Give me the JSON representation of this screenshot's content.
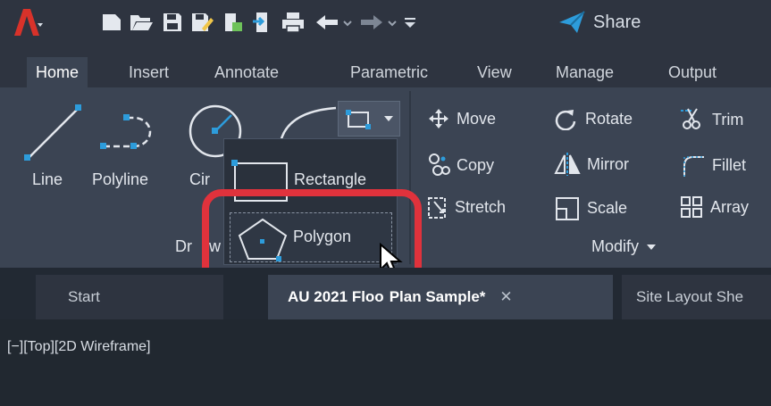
{
  "qat": {
    "share_label": "Share",
    "icons": [
      "autocad-logo-icon",
      "new-file-icon",
      "open-folder-icon",
      "save-icon",
      "save-as-icon",
      "plot-icon",
      "import-icon",
      "print-icon",
      "undo-icon",
      "redo-icon",
      "customize-dropdown-icon",
      "share-icon"
    ]
  },
  "ribbon_tabs": [
    "Home",
    "Insert",
    "Annotate",
    "Parametric",
    "View",
    "Manage",
    "Output"
  ],
  "draw": {
    "line": "Line",
    "polyline": "Polyline",
    "circle_partial": "Cir",
    "panel_partial": "Dr",
    "panel_partial_2": "w"
  },
  "flyout": {
    "rectangle": "Rectangle",
    "polygon": "Polygon"
  },
  "modify": {
    "move": "Move",
    "rotate": "Rotate",
    "trim": "Trim",
    "copy": "Copy",
    "mirror": "Mirror",
    "fillet": "Fillet",
    "stretch": "Stretch",
    "scale": "Scale",
    "array": "Array",
    "panel": "Modify"
  },
  "doc_tabs": {
    "start": "Start",
    "file_a": "AU 2021 Floo",
    "file_b": "Plan Sample*",
    "close": "✕",
    "file_c": "Site Layout She"
  },
  "viewport": {
    "controls": "[−][Top][2D Wireframe]"
  },
  "colors": {
    "accent": "#2d9cdb",
    "highlight": "#e0323c",
    "logo": "#d8322a"
  }
}
